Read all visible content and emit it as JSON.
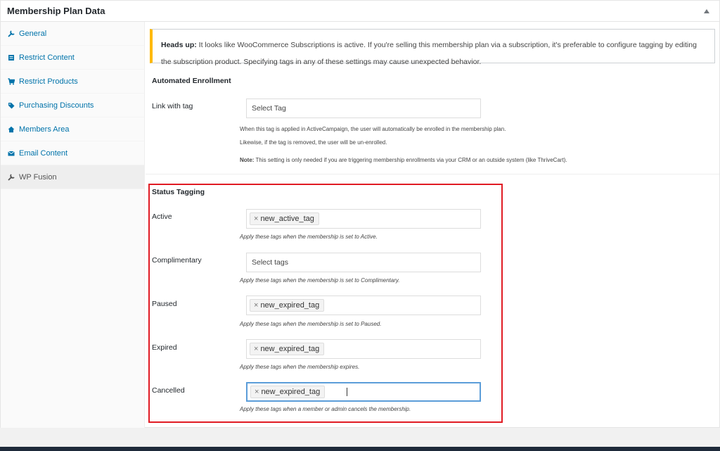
{
  "panel": {
    "title": "Membership Plan Data"
  },
  "sidebar": {
    "items": [
      {
        "label": "General",
        "icon": "wrench-icon"
      },
      {
        "label": "Restrict Content",
        "icon": "document-icon"
      },
      {
        "label": "Restrict Products",
        "icon": "cart-icon"
      },
      {
        "label": "Purchasing Discounts",
        "icon": "tag-icon"
      },
      {
        "label": "Members Area",
        "icon": "home-icon"
      },
      {
        "label": "Email Content",
        "icon": "email-icon"
      },
      {
        "label": "WP Fusion",
        "icon": "wrench-icon"
      }
    ],
    "active": "WP Fusion"
  },
  "notice": {
    "heading": "Heads up:",
    "text": " It looks like WooCommerce Subscriptions is active. If you're selling this membership plan via a subscription, it's preferable to configure tagging by editing the subscription product. Specifying tags in any of these settings may cause unexpected behavior."
  },
  "automated_enrollment": {
    "title": "Automated Enrollment",
    "link_label": "Link with tag",
    "link_placeholder": "Select Tag",
    "help1": "When this tag is applied in ActiveCampaign, the user will automatically be enrolled in the membership plan.",
    "help2": "Likewise, if the tag is removed, the user will be un-enrolled.",
    "note_label": "Note:",
    "note_text": " This setting is only needed if you are triggering membership enrollments via your CRM or an outside system (like ThriveCart)."
  },
  "status_tagging": {
    "title": "Status Tagging",
    "fields": [
      {
        "label": "Active",
        "tag": "new_active_tag",
        "placeholder": "",
        "help": "Apply these tags when the membership is set to Active."
      },
      {
        "label": "Complimentary",
        "tag": "",
        "placeholder": "Select tags",
        "help": "Apply these tags when the membership is set to Complimentary."
      },
      {
        "label": "Paused",
        "tag": "new_expired_tag",
        "placeholder": "",
        "help": "Apply these tags when the membership is set to Paused."
      },
      {
        "label": "Expired",
        "tag": "new_expired_tag",
        "placeholder": "",
        "help": "Apply these tags when the membership expires."
      },
      {
        "label": "Cancelled",
        "tag": "new_expired_tag",
        "placeholder": "",
        "help": "Apply these tags when a member or admin cancels the membership."
      }
    ]
  },
  "colors": {
    "link": "#0073aa",
    "notice_accent": "#ffb900",
    "highlight": "#e01b24",
    "focus": "#5b9dd9"
  }
}
